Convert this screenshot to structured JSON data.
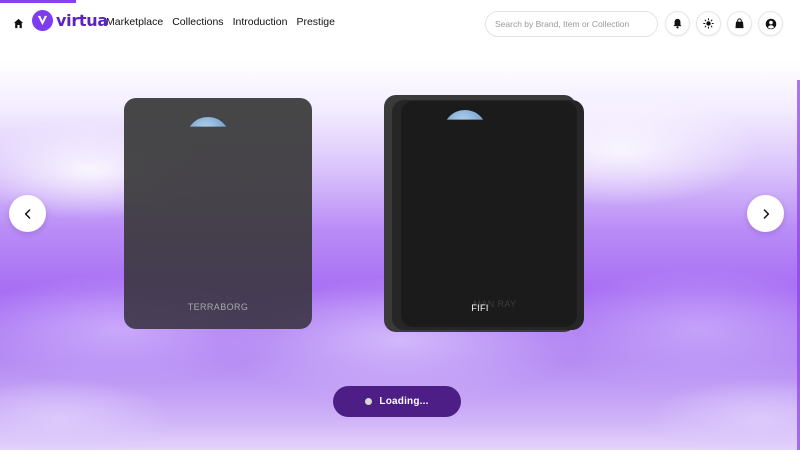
{
  "brand": {
    "name": "virtua"
  },
  "nav": {
    "links": [
      "Marketplace",
      "Collections",
      "Introduction",
      "Prestige"
    ]
  },
  "search": {
    "placeholder": "Search by Brand, Item or Collection",
    "value": ""
  },
  "header_icons": [
    "home-icon",
    "bell-icon",
    "sun-icon",
    "bag-icon",
    "user-icon"
  ],
  "carousel": {
    "cards": [
      {
        "label": "TERRABORG"
      },
      {
        "label": "FIFI",
        "ghost_label": "MAN RAY"
      }
    ],
    "prev_icon": "chevron-left-icon",
    "next_icon": "chevron-right-icon"
  },
  "loading": {
    "label": "Loading..."
  },
  "colors": {
    "brand_purple": "#7e3cf0",
    "loading_button": "#4c1e86",
    "card_dark": "#1b1b1b"
  }
}
